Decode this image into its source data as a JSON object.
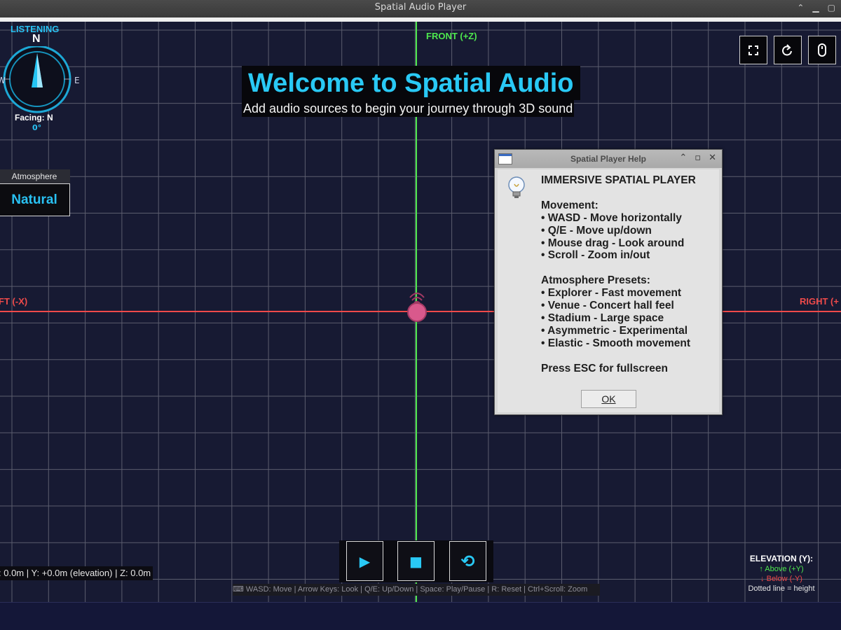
{
  "window": {
    "title": "Spatial Audio Player",
    "controls": [
      "^",
      "_",
      "□"
    ]
  },
  "axes": {
    "front": "FRONT (+Z)",
    "left": "FT (-X)",
    "right": "RIGHT (+"
  },
  "compass": {
    "listening": "LISTENING",
    "north": "N",
    "east": "E",
    "west": "W",
    "facing": "Facing: N",
    "degrees": "0°"
  },
  "atmosphere": {
    "label": "Atmosphere",
    "value": "Natural"
  },
  "welcome": {
    "title": "Welcome to Spatial Audio",
    "subtitle": "Add audio sources to begin your journey through 3D sound"
  },
  "top_right_buttons": [
    "fullscreen-icon",
    "rotate-icon",
    "mouse-icon"
  ],
  "help_dialog": {
    "title": "Spatial Player Help",
    "text": "IMMERSIVE SPATIAL PLAYER\n\nMovement:\n• WASD - Move horizontally\n• Q/E - Move up/down\n• Mouse drag - Look around\n• Scroll - Zoom in/out\n\nAtmosphere Presets:\n• Explorer - Fast movement\n• Venue - Concert hall feel\n• Stadium - Large space\n• Asymmetric - Experimental\n• Elastic - Smooth movement\n\nPress ESC for fullscreen",
    "ok": "OK"
  },
  "playback": {
    "play": "▶",
    "stop": "■",
    "reset": "⟲"
  },
  "status": {
    "coords": ": 0.0m | Y: +0.0m (elevation) | Z: 0.0m",
    "hints": "⌨ WASD: Move | Arrow Keys: Look | Q/E: Up/Down | Space: Play/Pause | R: Reset | Ctrl+Scroll: Zoom"
  },
  "elevation": {
    "heading": "ELEVATION (Y):",
    "above": "↑ Above (+Y)",
    "below": "↓ Below (-Y)",
    "dotted": "Dotted line = height"
  },
  "colors": {
    "accent": "#29c9f5",
    "front_axis": "#4ee84e",
    "side_axis": "#ef4a4a",
    "source": "#d9598c"
  }
}
